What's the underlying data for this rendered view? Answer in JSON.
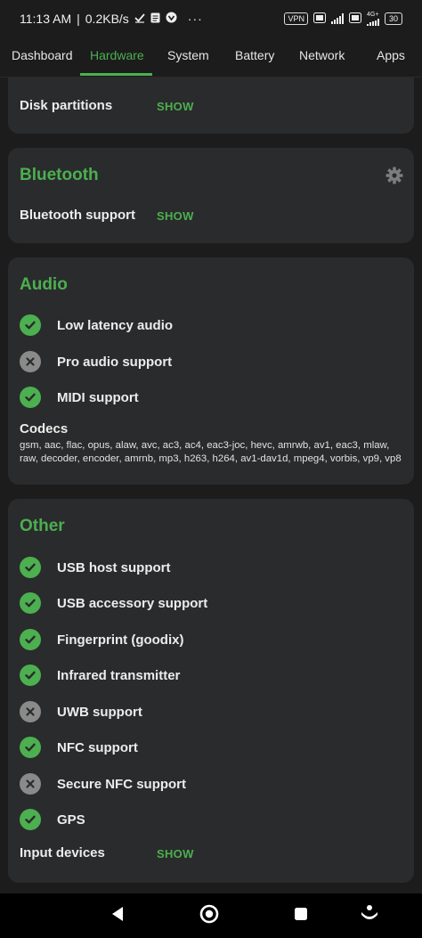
{
  "status": {
    "time": "11:13 AM",
    "speed": "0.2KB/s",
    "vpn": "VPN",
    "network": "4G+",
    "battery": "30"
  },
  "tabs": [
    "Dashboard",
    "Hardware",
    "System",
    "Battery",
    "Network",
    "Apps"
  ],
  "active_tab": "Hardware",
  "storage": {
    "partitions_label": "Disk partitions",
    "show": "SHOW"
  },
  "bluetooth": {
    "title": "Bluetooth",
    "support_label": "Bluetooth support",
    "show": "SHOW"
  },
  "audio": {
    "title": "Audio",
    "features": [
      {
        "label": "Low latency audio",
        "supported": true
      },
      {
        "label": "Pro audio support",
        "supported": false
      },
      {
        "label": "MIDI support",
        "supported": true
      }
    ],
    "codecs_label": "Codecs",
    "codecs_value": "gsm, aac, flac, opus, alaw, avc, ac3, ac4, eac3-joc, hevc, amrwb, av1, eac3, mlaw, raw, decoder, encoder, amrnb, mp3, h263, h264, av1-dav1d, mpeg4, vorbis, vp9, vp8"
  },
  "other": {
    "title": "Other",
    "features": [
      {
        "label": "USB host support",
        "supported": true
      },
      {
        "label": "USB accessory support",
        "supported": true
      },
      {
        "label": "Fingerprint (goodix)",
        "supported": true
      },
      {
        "label": "Infrared transmitter",
        "supported": true
      },
      {
        "label": "UWB support",
        "supported": false
      },
      {
        "label": "NFC support",
        "supported": true
      },
      {
        "label": "Secure NFC support",
        "supported": false
      },
      {
        "label": "GPS",
        "supported": true
      }
    ],
    "input_devices_label": "Input devices",
    "show": "SHOW"
  },
  "icons": {
    "supported": "check-circle-icon",
    "unsupported": "x-circle-icon",
    "settings": "gear-icon"
  },
  "colors": {
    "accent": "#4caf50",
    "background": "#1c1c1d",
    "card": "#2a2b2c",
    "unsupported": "#8a8a8a"
  }
}
